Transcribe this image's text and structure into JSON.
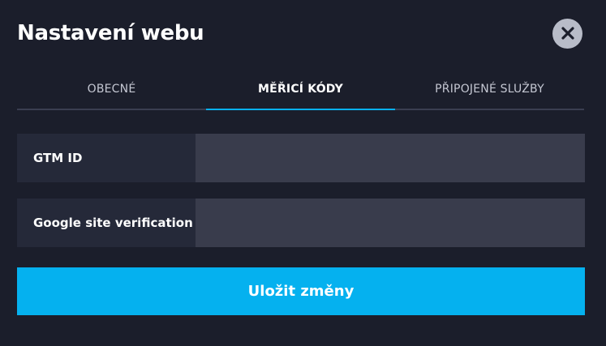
{
  "modal": {
    "title": "Nastavení webu",
    "close_icon": "close-icon"
  },
  "tabs": [
    {
      "label": "OBECNÉ",
      "active": false
    },
    {
      "label": "MĚŘICÍ KÓDY",
      "active": true
    },
    {
      "label": "PŘIPOJENÉ SLUŽBY",
      "active": false
    }
  ],
  "fields": [
    {
      "label": "GTM ID",
      "value": ""
    },
    {
      "label": "Google site verification",
      "value": ""
    }
  ],
  "save_button": {
    "label": "Uložit změny"
  },
  "colors": {
    "background": "#1b1e2b",
    "accent": "#05b1ef",
    "label_bg": "#252939",
    "input_bg": "#393c4c",
    "close_bg": "#b8bcc8"
  }
}
